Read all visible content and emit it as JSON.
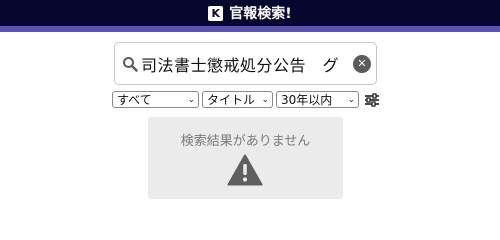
{
  "header": {
    "logo_letter": "K",
    "title": "官報検索!",
    "background_color": "#06062e",
    "accent_color": "#5a52b6"
  },
  "search": {
    "value": "司法書士懲戒処分公告　グ",
    "icon": "search-icon",
    "clear_icon": "close-icon"
  },
  "filters": {
    "scope": {
      "selected": "すべて"
    },
    "field": {
      "selected": "タイトル"
    },
    "period": {
      "selected": "30年以内"
    },
    "settings_icon": "sliders-icon"
  },
  "results": {
    "empty_message": "検索結果がありません",
    "icon": "warning-icon"
  }
}
